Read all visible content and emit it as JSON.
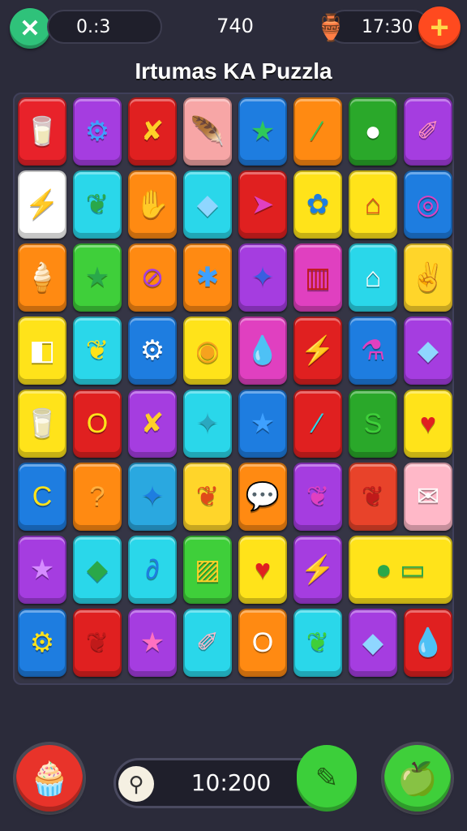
{
  "hud": {
    "close_icon": "✕",
    "moves": "0.:3",
    "score": "740",
    "coin_icon": "🏺",
    "time": "17:30",
    "plus_icon": "+"
  },
  "title": "Irtumas KA Puzzla",
  "board": {
    "rows": [
      [
        {
          "bg": "#e8222a",
          "g": "🥛",
          "c": "#fff"
        },
        {
          "bg": "#a53de0",
          "g": "⚙",
          "c": "#3ea0ff"
        },
        {
          "bg": "#e02020",
          "g": "✘",
          "c": "#ffd028"
        },
        {
          "bg": "#f7a6a6",
          "g": "🪶",
          "c": "#f0b020"
        },
        {
          "bg": "#1e7de0",
          "g": "★",
          "c": "#2fc85a"
        },
        {
          "bg": "#ff8a12",
          "g": "⁄",
          "c": "#2fc85a"
        },
        {
          "bg": "#2aa82a",
          "g": "●",
          "c": "#fff"
        },
        {
          "bg": "#a53de0",
          "g": "✐",
          "c": "#ff8fc0"
        }
      ],
      [
        {
          "bg": "#ffffff",
          "g": "⚡",
          "c": "#f6a21e"
        },
        {
          "bg": "#2ad7ea",
          "g": "❦",
          "c": "#2aa84a"
        },
        {
          "bg": "#ff8a12",
          "g": "✋",
          "c": "#ffcf50"
        },
        {
          "bg": "#2ad7ea",
          "g": "◆",
          "c": "#8fd6ff"
        },
        {
          "bg": "#e02020",
          "g": "➤",
          "c": "#e040c0"
        },
        {
          "bg": "#ffe31a",
          "g": "✿",
          "c": "#1e7de0"
        },
        {
          "bg": "#ffe31a",
          "g": "⌂",
          "c": "#e04b1a"
        },
        {
          "bg": "#1e7de0",
          "g": "◎",
          "c": "#e040c0"
        }
      ],
      [
        {
          "bg": "#ff8a12",
          "g": "🍦",
          "c": "#fff"
        },
        {
          "bg": "#3fcf3a",
          "g": "★",
          "c": "#2aa84a"
        },
        {
          "bg": "#ff8a12",
          "g": "⊘",
          "c": "#a53de0"
        },
        {
          "bg": "#ff8a12",
          "g": "✱",
          "c": "#3ea0ff"
        },
        {
          "bg": "#a53de0",
          "g": "✦",
          "c": "#3a5fe0"
        },
        {
          "bg": "#e040c0",
          "g": "▥",
          "c": "#c01a1a"
        },
        {
          "bg": "#2ad7ea",
          "g": "⌂",
          "c": "#fff"
        },
        {
          "bg": "#ffd52a",
          "g": "✌",
          "c": "#f7a6a6"
        }
      ],
      [
        {
          "bg": "#ffe31a",
          "g": "◧",
          "c": "#fff"
        },
        {
          "bg": "#2ad7ea",
          "g": "❦",
          "c": "#ffe31a"
        },
        {
          "bg": "#1e7de0",
          "g": "⚙",
          "c": "#fff"
        },
        {
          "bg": "#ffe31a",
          "g": "◉",
          "c": "#f6a21e"
        },
        {
          "bg": "#e040c0",
          "g": "💧",
          "c": "#2ad7ea"
        },
        {
          "bg": "#e02020",
          "g": "⚡",
          "c": "#ffe31a"
        },
        {
          "bg": "#1e7de0",
          "g": "⚗",
          "c": "#e040c0"
        },
        {
          "bg": "#a53de0",
          "g": "◆",
          "c": "#8fd6ff"
        }
      ],
      [
        {
          "bg": "#ffe31a",
          "g": "🥛",
          "c": "#fff"
        },
        {
          "bg": "#e02020",
          "g": "O",
          "c": "#ffe31a"
        },
        {
          "bg": "#a53de0",
          "g": "✘",
          "c": "#ffd028"
        },
        {
          "bg": "#2ad7ea",
          "g": "✦",
          "c": "#2aa8c0"
        },
        {
          "bg": "#1e7de0",
          "g": "★",
          "c": "#3ea0ff"
        },
        {
          "bg": "#e02020",
          "g": "⁄",
          "c": "#2ad7ea"
        },
        {
          "bg": "#2aa82a",
          "g": "S",
          "c": "#3fcf3a"
        },
        {
          "bg": "#ffe31a",
          "g": "♥",
          "c": "#e02020"
        }
      ],
      [
        {
          "bg": "#1e7de0",
          "g": "C",
          "c": "#ffe31a"
        },
        {
          "bg": "#ff8a12",
          "g": "?",
          "c": "#ffb040"
        },
        {
          "bg": "#2aa8e0",
          "g": "✦",
          "c": "#1e7de0"
        },
        {
          "bg": "#ffd52a",
          "g": "❦",
          "c": "#e04b1a"
        },
        {
          "bg": "#ff8a12",
          "g": "💬",
          "c": "#2ad7ea"
        },
        {
          "bg": "#a53de0",
          "g": "❦",
          "c": "#e040c0"
        },
        {
          "bg": "#e8432a",
          "g": "❦",
          "c": "#c01a1a"
        },
        {
          "bg": "#ffb8c8",
          "g": "✉",
          "c": "#fff"
        }
      ],
      [
        {
          "bg": "#a53de0",
          "g": "★",
          "c": "#d58cff"
        },
        {
          "bg": "#2ad7ea",
          "g": "◆",
          "c": "#2aa84a"
        },
        {
          "bg": "#2ad7ea",
          "g": "∂",
          "c": "#1e7de0"
        },
        {
          "bg": "#3fcf3a",
          "g": "▨",
          "c": "#ffd028"
        },
        {
          "bg": "#ffe31a",
          "g": "♥",
          "c": "#e02020"
        },
        {
          "bg": "#a53de0",
          "g": "⚡",
          "c": "#ffe31a"
        },
        {
          "bg": "#ffe31a",
          "g": "● ▭",
          "c": "#2aa84a",
          "wide": true
        }
      ],
      [
        {
          "bg": "#1e7de0",
          "g": "⚙",
          "c": "#ffe31a"
        },
        {
          "bg": "#e02020",
          "g": "❦",
          "c": "#c01a1a"
        },
        {
          "bg": "#a53de0",
          "g": "★",
          "c": "#ff70c0"
        },
        {
          "bg": "#2ad7ea",
          "g": "✐",
          "c": "#ffb8c8"
        },
        {
          "bg": "#ff8a12",
          "g": "O",
          "c": "#fff"
        },
        {
          "bg": "#2ad7ea",
          "g": "❦",
          "c": "#3fcf3a"
        },
        {
          "bg": "#a53de0",
          "g": "◆",
          "c": "#8fd6ff"
        },
        {
          "bg": "#e02020",
          "g": "💧",
          "c": "#2ad7ea"
        }
      ]
    ]
  },
  "bottom": {
    "left_icon": "🧁",
    "bar_icon": "⚲",
    "value": "10:200",
    "bar_button_icon": "✎",
    "right_icon": "🍏"
  }
}
